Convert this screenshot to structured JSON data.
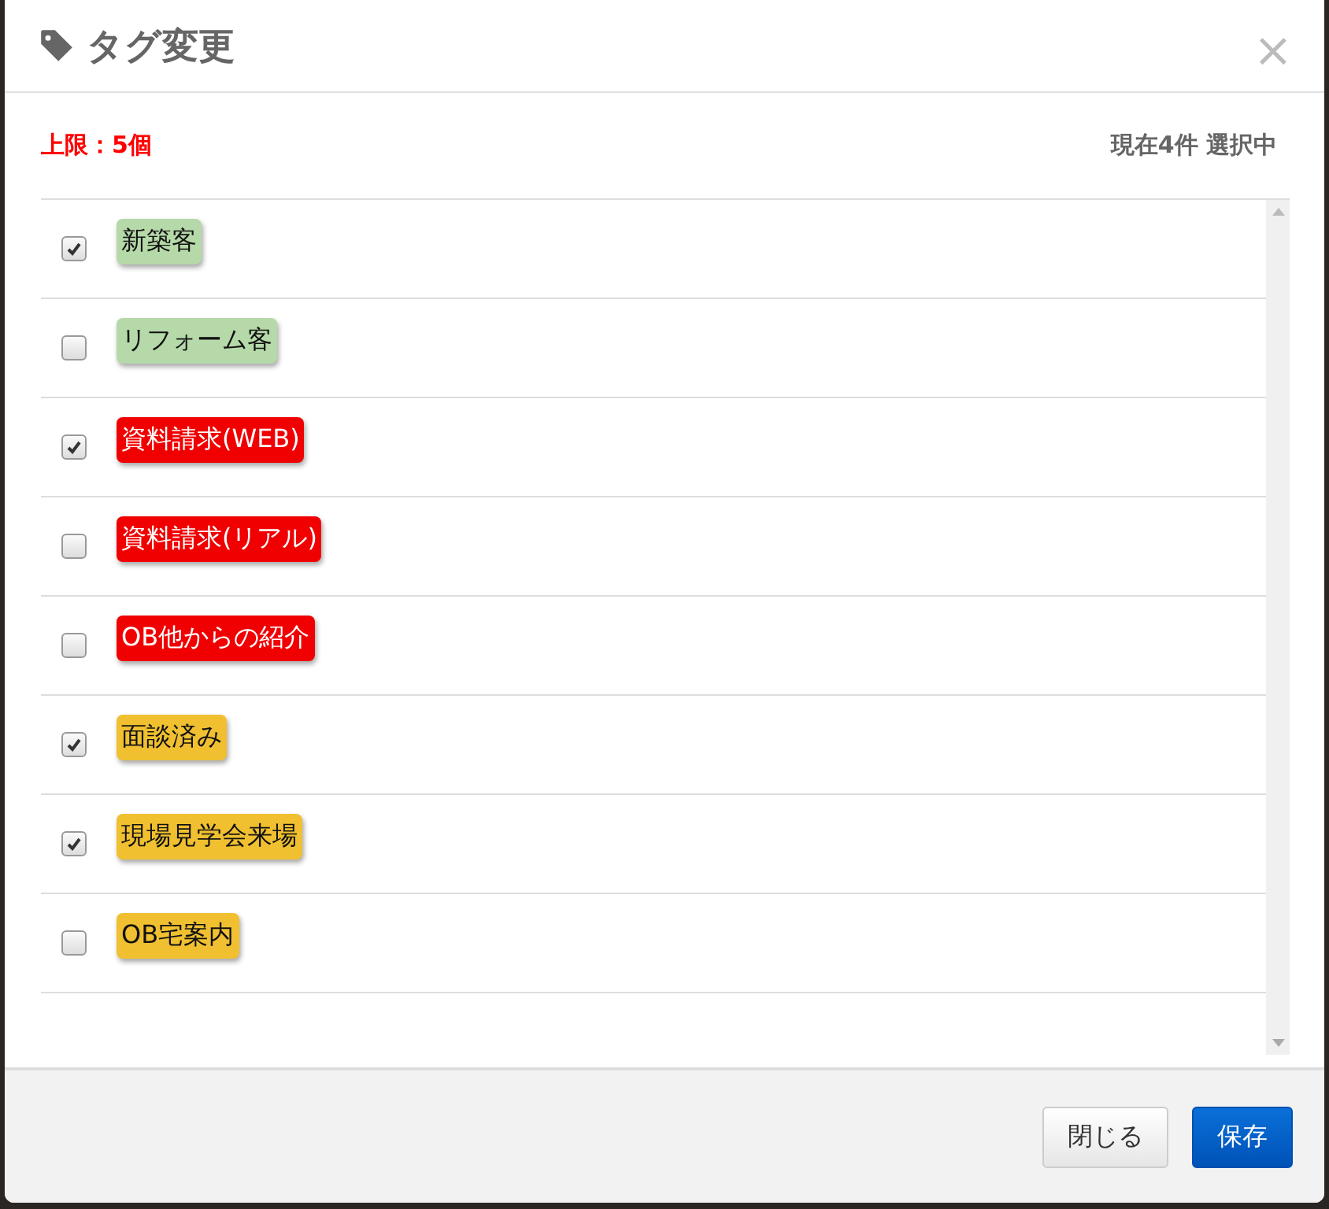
{
  "dialog": {
    "title": "タグ変更",
    "close": "×"
  },
  "limit": "上限：5個",
  "selection_count": "現在4件 選択中",
  "tags": [
    {
      "label": "新築客",
      "color": "#b5d9a8",
      "checked": true
    },
    {
      "label": "リフォーム客",
      "color": "#b5d9a8",
      "checked": false
    },
    {
      "label": "資料請求(WEB)",
      "color": "#f00000",
      "checked": true
    },
    {
      "label": "資料請求(リアル)",
      "color": "#f00000",
      "checked": false
    },
    {
      "label": "OB他からの紹介",
      "color": "#f00000",
      "checked": false
    },
    {
      "label": "面談済み",
      "color": "#f0c030",
      "checked": true
    },
    {
      "label": "現場見学会来場",
      "color": "#f0c030",
      "checked": true
    },
    {
      "label": "OB宅案内",
      "color": "#f0c030",
      "checked": false
    }
  ],
  "buttons": [
    {
      "label": "閉じる",
      "kind": "secondary"
    },
    {
      "label": "保存",
      "kind": "primary"
    }
  ]
}
